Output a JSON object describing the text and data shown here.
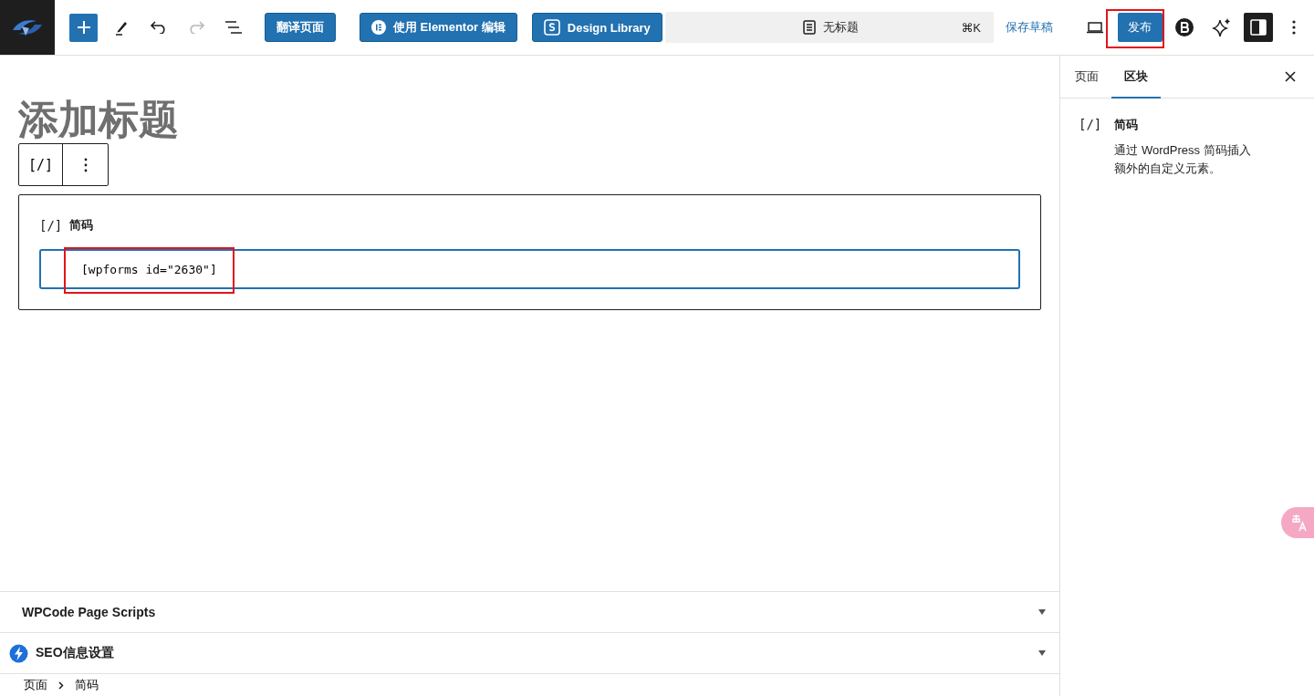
{
  "header": {
    "buttons": [
      {
        "label": "翻译页面",
        "kind": "text"
      },
      {
        "label": "使用 Elementor 编辑",
        "kind": "elementor"
      },
      {
        "label": "Design Library",
        "kind": "library"
      }
    ],
    "command_bar": {
      "title": "无标题",
      "shortcut": "⌘K"
    },
    "save_draft": "保存草稿",
    "publish": "发布",
    "redo_disabled": true
  },
  "editor": {
    "title_placeholder": "添加标题",
    "block_toolbar": {
      "block_icon": "[/]"
    },
    "block": {
      "icon": "[/]",
      "label": "简码",
      "value": "[wpforms id=\"2630\"]"
    }
  },
  "metaboxes": [
    {
      "title": "WPCode Page Scripts",
      "kind": "plain",
      "expanded": false
    },
    {
      "title": "SEO信息设置",
      "kind": "seo",
      "expanded": false
    }
  ],
  "breadcrumb": [
    "页面",
    "简码"
  ],
  "sidebar": {
    "tabs": [
      {
        "label": "页面",
        "selected": false
      },
      {
        "label": "区块",
        "selected": true
      }
    ],
    "block_card": {
      "icon": "[/]",
      "title": "简码",
      "description": "通过 WordPress 简码插入额外的自定义元素。"
    }
  }
}
